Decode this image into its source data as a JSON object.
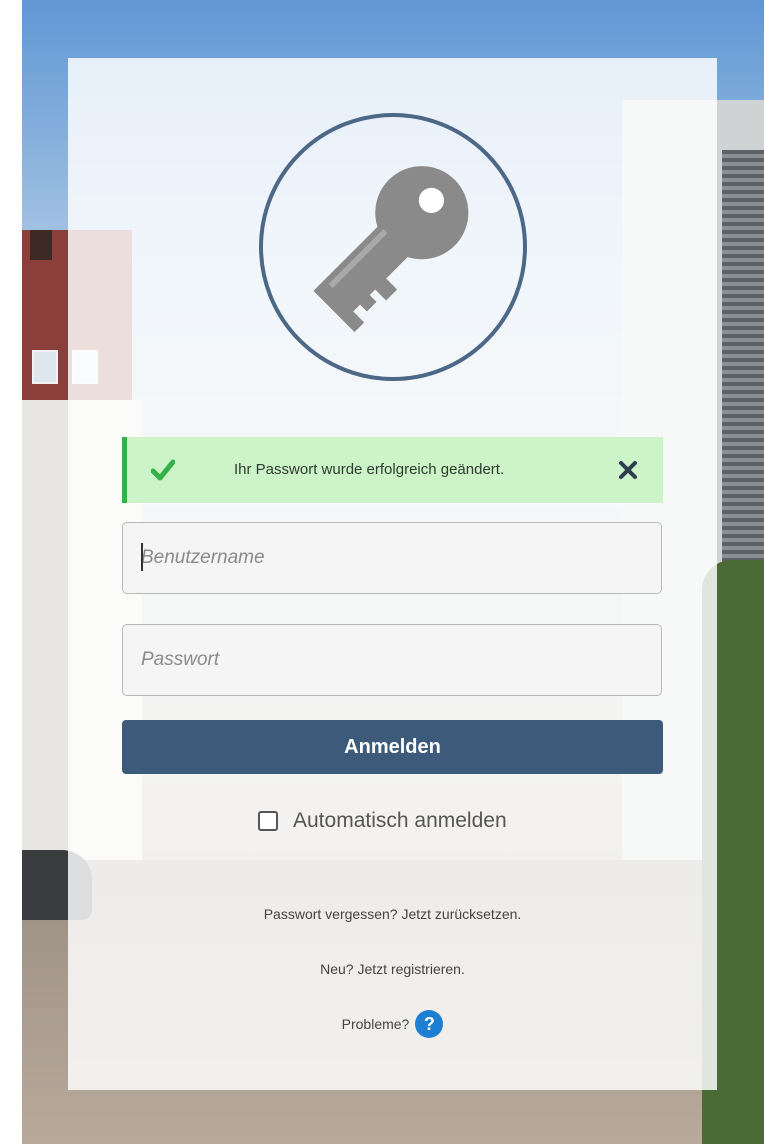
{
  "alert": {
    "message": "Ihr Passwort wurde erfolgreich geändert.",
    "icon": "check-icon",
    "close_icon": "close-icon",
    "accent_color": "#36b14a",
    "background_color": "#ccf4c8"
  },
  "form": {
    "username_placeholder": "Benutzername",
    "username_value": "",
    "password_placeholder": "Passwort",
    "password_value": "",
    "submit_label": "Anmelden",
    "remember_label": "Automatisch anmelden",
    "remember_checked": false
  },
  "links": {
    "forgot_prefix": "Passwort vergessen?",
    "forgot_link": "Jetzt zurücksetzen.",
    "register_prefix": "Neu?",
    "register_link": "Jetzt registrieren.",
    "problems_label": "Probleme?",
    "help_glyph": "?"
  },
  "logo": {
    "icon": "key-icon"
  },
  "colors": {
    "primary": "#3d5a7a",
    "help": "#1c7fd3"
  }
}
